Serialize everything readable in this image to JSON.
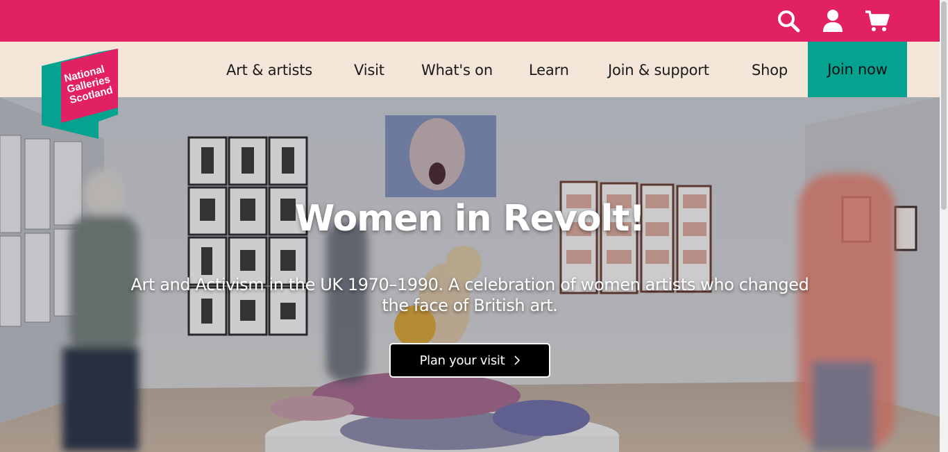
{
  "site": {
    "logo_text": [
      "National",
      "Galleries",
      "Scotland"
    ],
    "brand_colors": {
      "pink": "#e12163",
      "teal": "#05a38f",
      "cream": "#f3e5d7"
    }
  },
  "utility": {
    "icons": [
      "search-icon",
      "account-icon",
      "cart-icon"
    ]
  },
  "nav": {
    "items": [
      {
        "label": "Art & artists"
      },
      {
        "label": "Visit"
      },
      {
        "label": "What's on"
      },
      {
        "label": "Learn"
      },
      {
        "label": "Join & support"
      },
      {
        "label": "Shop"
      }
    ],
    "cta_label": "Join now"
  },
  "hero": {
    "title": "Women in Revolt!",
    "subtitle": "Art and Activism in the UK 1970–1990. A celebration of women artists who changed the face of British art.",
    "button_label": "Plan your visit"
  }
}
